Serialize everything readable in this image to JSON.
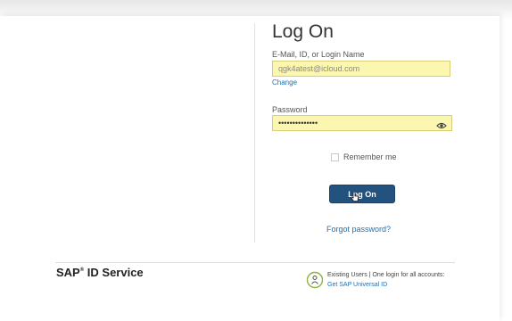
{
  "login": {
    "title": "Log On",
    "email_label": "E-Mail, ID, or Login Name",
    "email_value": "qgk4atest@icloud.com",
    "change_link": "Change",
    "password_label": "Password",
    "password_value": "••••••••••••••",
    "remember_label": "Remember me",
    "logon_button": "Log On",
    "forgot_link": "Forgot password?"
  },
  "footer": {
    "brand_sap": "SAP",
    "brand_mark": "®",
    "brand_service": "ID Service",
    "existing_users_text": "Existing Users | One login for all accounts:",
    "universal_link": "Get SAP Universal ID"
  },
  "icons": {
    "password_toggle": "eye-icon",
    "universal_id": "sap-id-icon",
    "pointer": "hand-cursor-icon"
  },
  "colors": {
    "input_fill": "#fbf6b0",
    "button": "#24527f",
    "link": "#1f6fb2"
  }
}
